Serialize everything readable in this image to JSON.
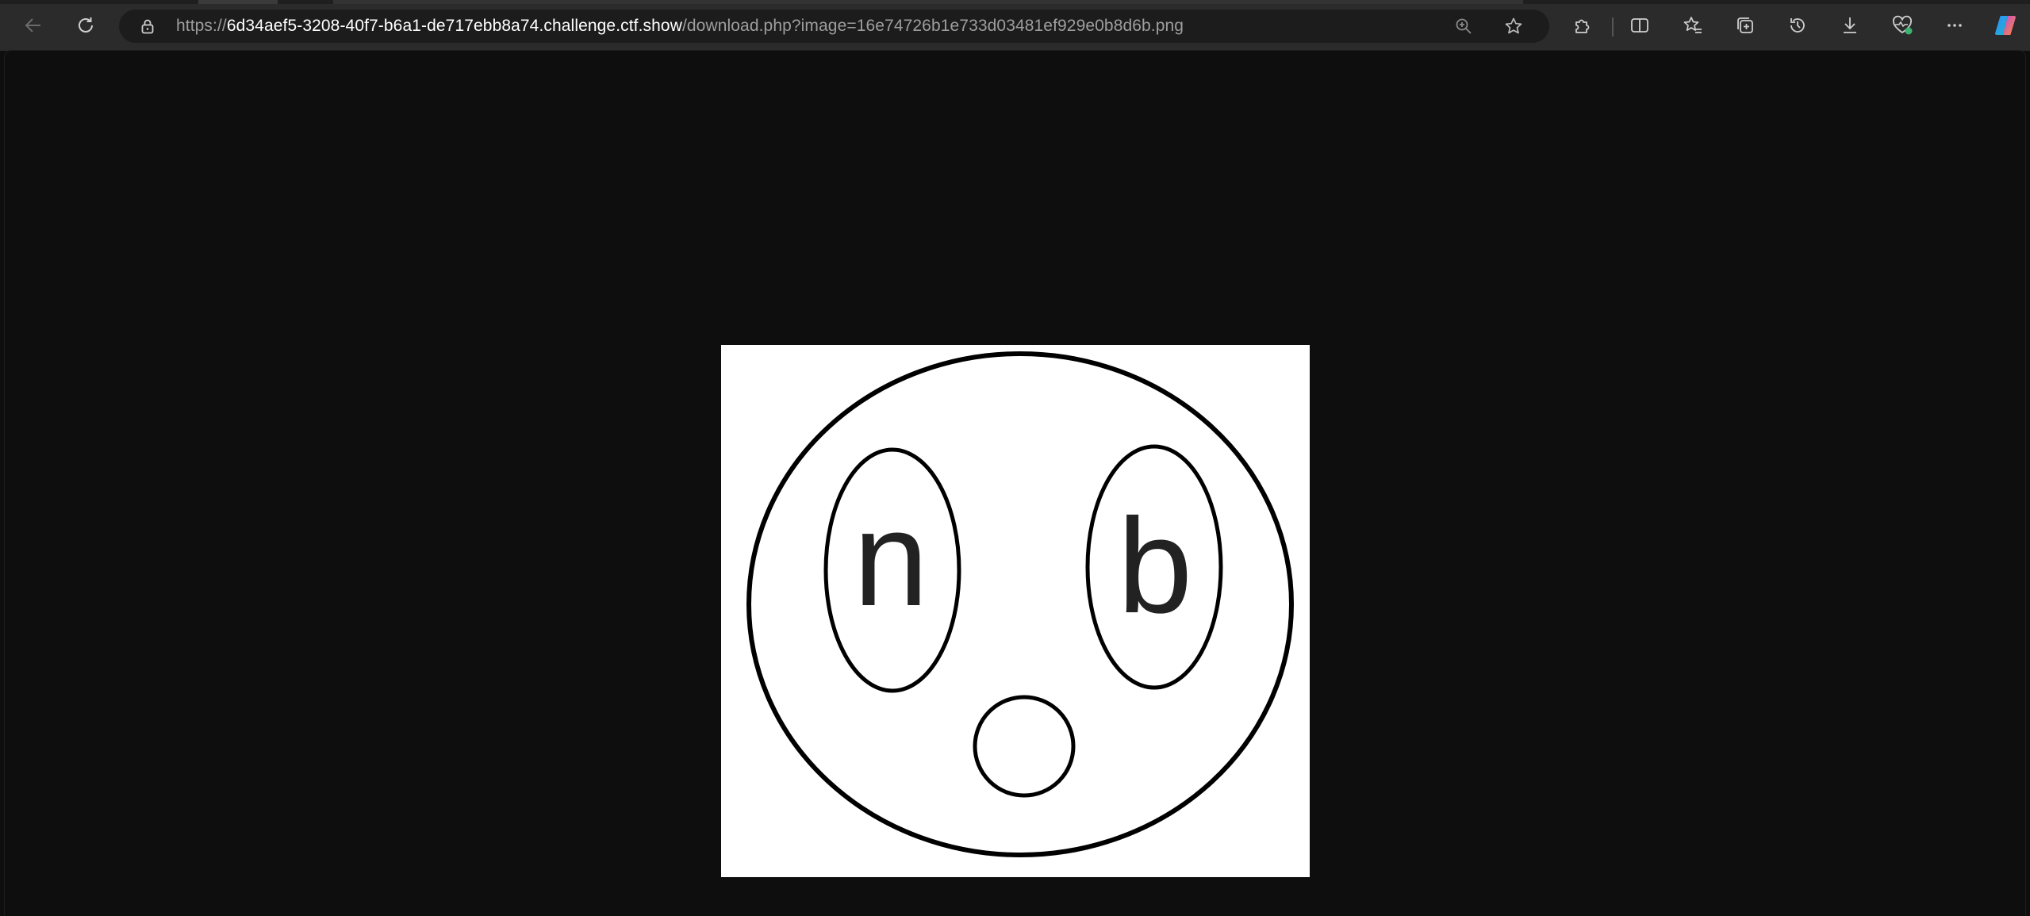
{
  "browser": {
    "url": {
      "scheme": "https://",
      "host": "6d34aef5-3208-40f7-b6a1-de717ebb8a74.challenge.ctf.show",
      "path": "/download.php?image=16e74726b1e733d03481ef929e0b8d6b.png"
    },
    "icons": {
      "back": "back-arrow-icon",
      "refresh": "refresh-icon",
      "lock": "lock-icon",
      "zoom": "zoom-icon",
      "favorite": "star-icon",
      "extensions": "puzzle-icon",
      "split_screen": "split-screen-icon",
      "favorites": "favorites-icon",
      "collections": "collections-icon",
      "history": "history-icon",
      "downloads": "download-icon",
      "browser_essentials": "heart-pulse-icon",
      "more": "more-icon",
      "copilot": "copilot-icon"
    }
  },
  "image": {
    "left_eye_letter": "n",
    "right_eye_letter": "b"
  },
  "colors": {
    "toolbar": "#2b2b2b",
    "address_bar": "#1c1c1c",
    "page_background": "#0e0e0e",
    "image_background": "#ffffff",
    "ink": "#000000",
    "letter": "#222222",
    "status_green": "#3cb371"
  }
}
